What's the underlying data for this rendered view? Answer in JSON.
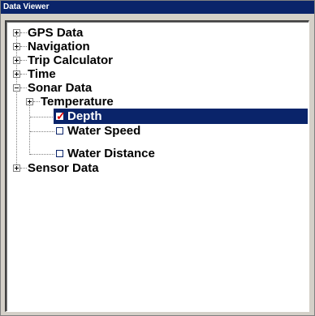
{
  "window": {
    "title": "Data Viewer"
  },
  "tree": {
    "items": [
      {
        "label": "GPS Data",
        "state": "collapsed"
      },
      {
        "label": "Navigation",
        "state": "collapsed"
      },
      {
        "label": "Trip Calculator",
        "state": "collapsed"
      },
      {
        "label": "Time",
        "state": "collapsed"
      },
      {
        "label": "Sonar Data",
        "state": "expanded"
      },
      {
        "label": "Temperature",
        "state": "collapsed"
      },
      {
        "label": "Depth",
        "checked": true,
        "selected": true
      },
      {
        "label": "Water Speed",
        "checked": false
      },
      {
        "label": "Water Distance",
        "checked": false
      },
      {
        "label": "Sensor Data",
        "state": "collapsed"
      }
    ]
  },
  "colors": {
    "selection": "#0a246a",
    "check": "#e00000"
  },
  "icons": {
    "collapsed": "plus-box-icon",
    "expanded": "minus-box-icon",
    "checkbox": "checkbox-icon"
  }
}
